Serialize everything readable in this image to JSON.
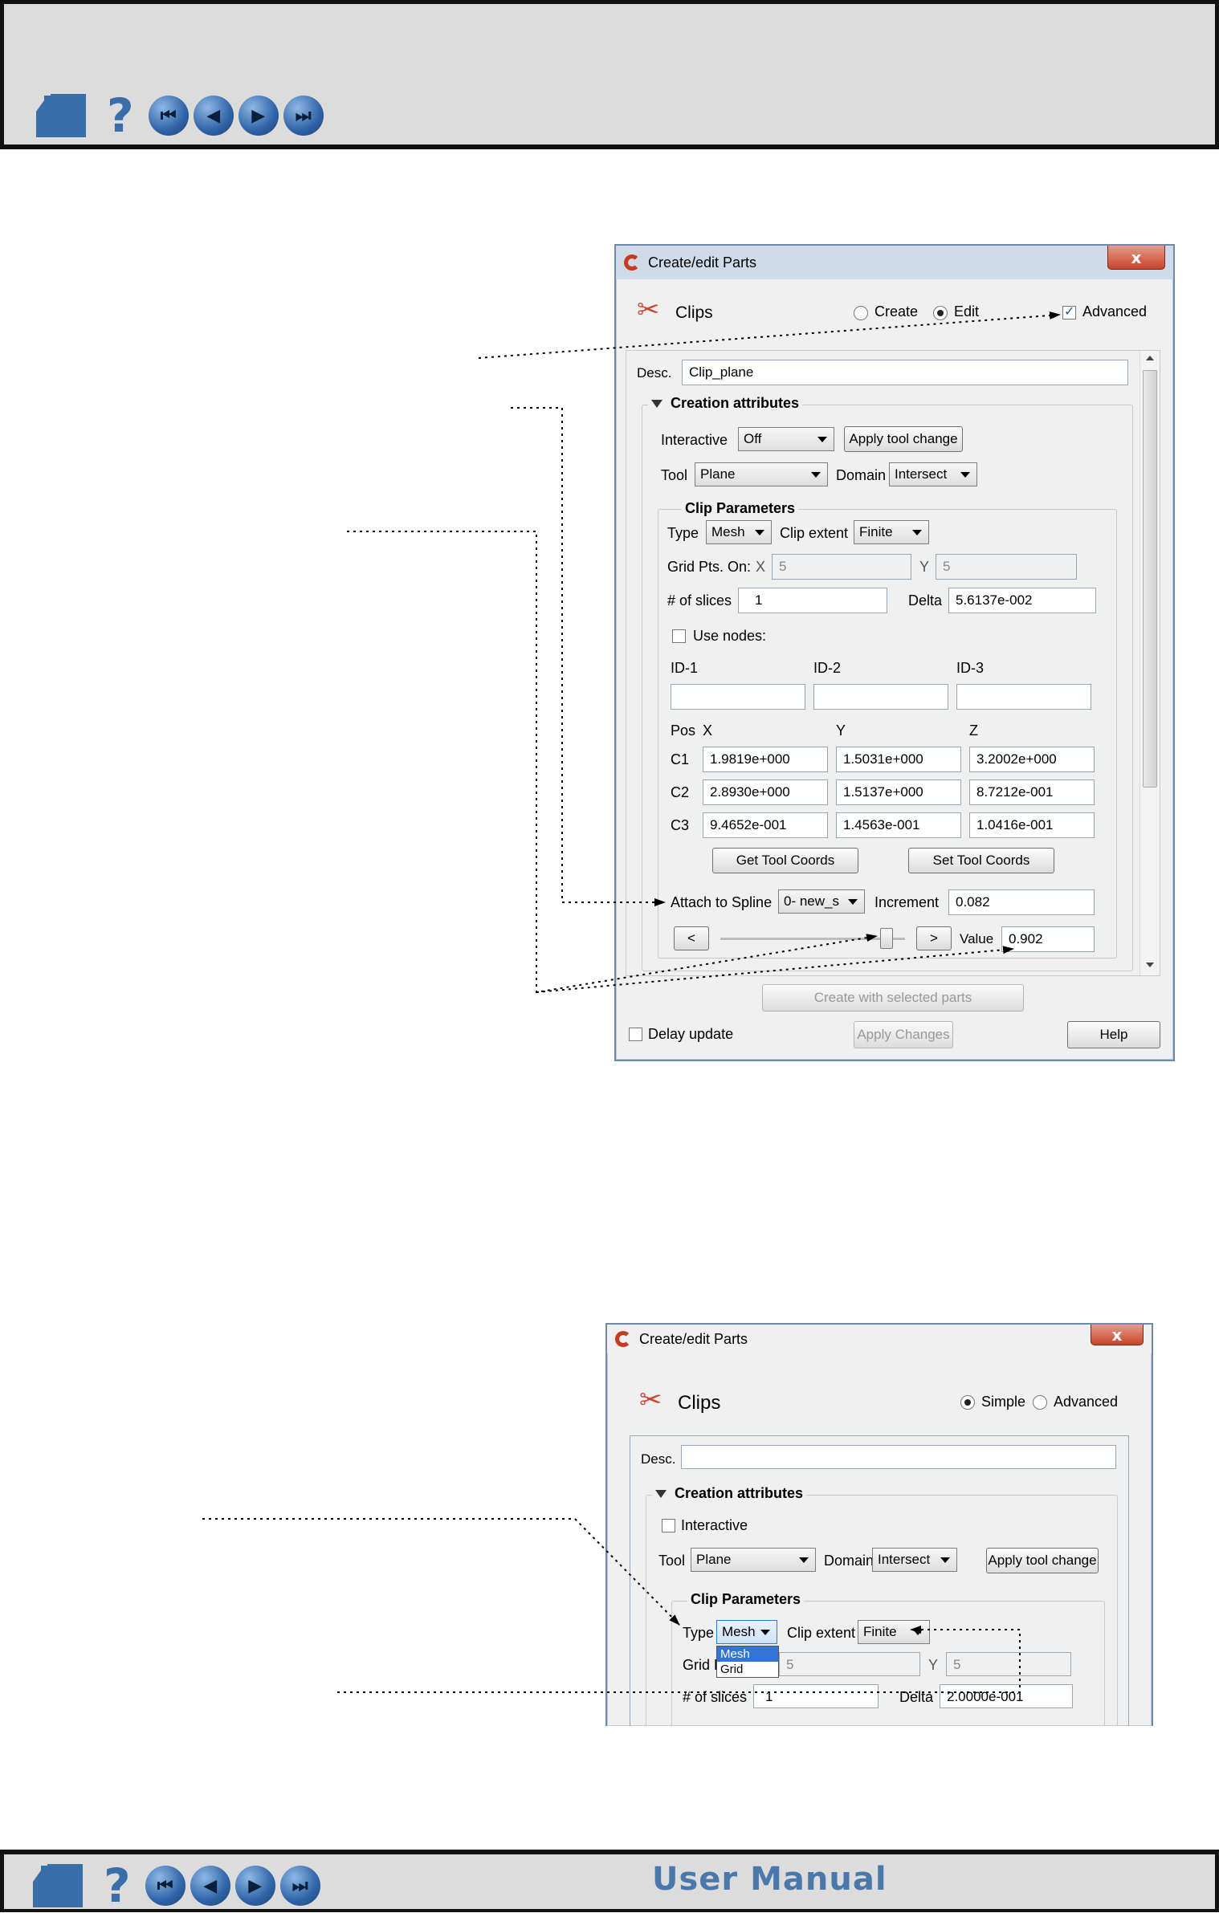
{
  "footer": {
    "title": "User Manual"
  },
  "nav": {
    "help_glyph": "?"
  },
  "dlg1": {
    "title": "Create/edit Parts",
    "close": "x",
    "section": "Clips",
    "mode": {
      "create": "Create",
      "edit": "Edit",
      "selected": "Edit"
    },
    "advanced": {
      "label": "Advanced",
      "checked": true
    },
    "desc_label": "Desc.",
    "desc_value": "Clip_plane",
    "creation_attributes": "Creation attributes",
    "interactive_label": "Interactive",
    "interactive_value": "Off",
    "apply_tool_change": "Apply tool change",
    "tool_label": "Tool",
    "tool_value": "Plane",
    "domain_label": "Domain",
    "domain_value": "Intersect",
    "clip_parameters": "Clip Parameters",
    "type_label": "Type",
    "type_value": "Mesh",
    "clip_extent_label": "Clip extent",
    "clip_extent_value": "Finite",
    "grid_pts_label": "Grid Pts. On:",
    "grid_x_label": "X",
    "grid_x_value": "5",
    "grid_y_label": "Y",
    "grid_y_value": "5",
    "slices_label": "# of slices",
    "slices_value": "1",
    "delta_label": "Delta",
    "delta_value": "5.6137e-002",
    "use_nodes_label": "Use nodes:",
    "id1": "ID-1",
    "id2": "ID-2",
    "id3": "ID-3",
    "pos_label": "Pos",
    "x_head": "X",
    "y_head": "Y",
    "z_head": "Z",
    "rows": [
      {
        "label": "C1",
        "x": "1.9819e+000",
        "y": "1.5031e+000",
        "z": "3.2002e+000"
      },
      {
        "label": "C2",
        "x": "2.8930e+000",
        "y": "1.5137e+000",
        "z": "8.7212e-001"
      },
      {
        "label": "C3",
        "x": "9.4652e-001",
        "y": "1.4563e-001",
        "z": "1.0416e-001"
      }
    ],
    "get_tool_coords": "Get Tool Coords",
    "set_tool_coords": "Set Tool Coords",
    "attach_label": "Attach to Spline",
    "attach_value": "0- new_s",
    "increment_label": "Increment",
    "increment_value": "0.082",
    "prev": "<",
    "next": ">",
    "value_label": "Value",
    "value_value": "0.902",
    "slider_fraction": 0.9,
    "create_selected": "Create with selected parts",
    "delay_update": "Delay update",
    "apply_changes": "Apply Changes",
    "help": "Help"
  },
  "dlg2": {
    "title": "Create/edit Parts",
    "close": "x",
    "section": "Clips",
    "mode": {
      "simple": "Simple",
      "advanced": "Advanced",
      "selected": "Simple"
    },
    "desc_label": "Desc.",
    "desc_value": "",
    "creation_attributes": "Creation attributes",
    "interactive_label": "Interactive",
    "tool_label": "Tool",
    "tool_value": "Plane",
    "domain_label": "Domain",
    "domain_value": "Intersect",
    "apply_tool_change": "Apply tool change",
    "clip_parameters": "Clip Parameters",
    "type_label": "Type",
    "type_value": "Mesh",
    "type_options": [
      "Mesh",
      "Grid"
    ],
    "clip_extent_label": "Clip extent",
    "clip_extent_value": "Finite",
    "grid_label": "Grid P",
    "grid_x_value": "5",
    "grid_y_label": "Y",
    "grid_y_value": "5",
    "slices_label": "# of slices",
    "slices_value": "1",
    "delta_label": "Delta",
    "delta_value": "2.0000e-001"
  },
  "colors": {
    "band": "#dcdcdc",
    "accent": "#3a6ea8",
    "title_blue": "#cfdbe9",
    "close_red": "#c6442b",
    "selected_blue": "#3375d6"
  },
  "icons": [
    "home-icon",
    "help-icon",
    "first-page-icon",
    "prev-page-icon",
    "next-page-icon",
    "last-page-icon",
    "scissors-icon",
    "close-icon",
    "chevron-down-icon"
  ]
}
